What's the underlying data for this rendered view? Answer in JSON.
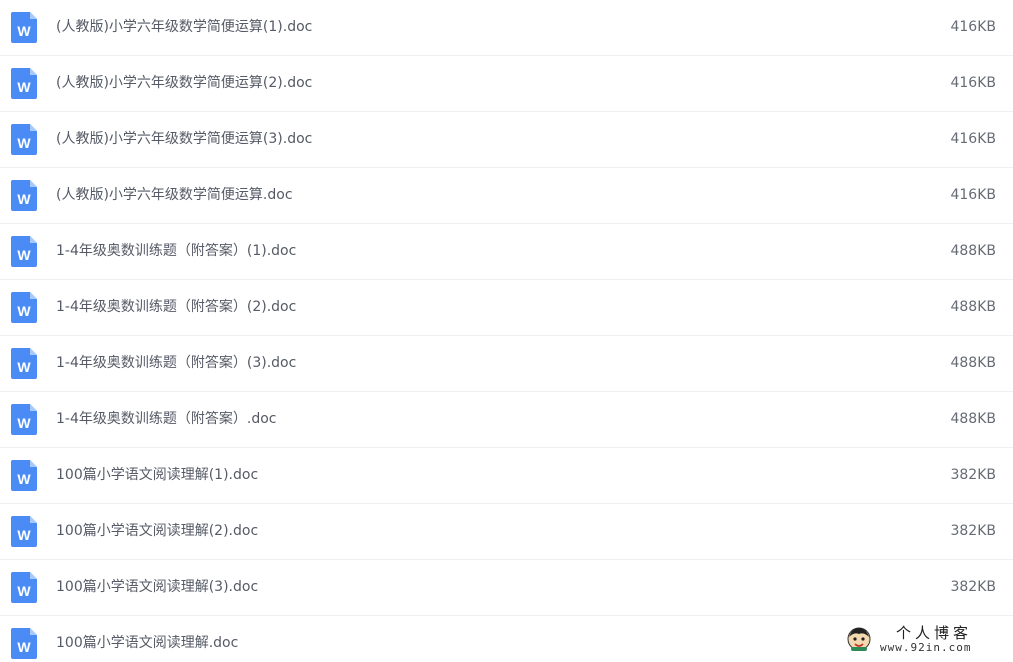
{
  "files": [
    {
      "name": "(人教版)小学六年级数学简便运算(1).doc",
      "size": "416KB",
      "icon": "word-doc-icon"
    },
    {
      "name": "(人教版)小学六年级数学简便运算(2).doc",
      "size": "416KB",
      "icon": "word-doc-icon"
    },
    {
      "name": "(人教版)小学六年级数学简便运算(3).doc",
      "size": "416KB",
      "icon": "word-doc-icon"
    },
    {
      "name": "(人教版)小学六年级数学简便运算.doc",
      "size": "416KB",
      "icon": "word-doc-icon"
    },
    {
      "name": "1-4年级奥数训练题（附答案）(1).doc",
      "size": "488KB",
      "icon": "word-doc-icon"
    },
    {
      "name": "1-4年级奥数训练题（附答案）(2).doc",
      "size": "488KB",
      "icon": "word-doc-icon"
    },
    {
      "name": "1-4年级奥数训练题（附答案）(3).doc",
      "size": "488KB",
      "icon": "word-doc-icon"
    },
    {
      "name": "1-4年级奥数训练题（附答案）.doc",
      "size": "488KB",
      "icon": "word-doc-icon"
    },
    {
      "name": "100篇小学语文阅读理解(1).doc",
      "size": "382KB",
      "icon": "word-doc-icon"
    },
    {
      "name": "100篇小学语文阅读理解(2).doc",
      "size": "382KB",
      "icon": "word-doc-icon"
    },
    {
      "name": "100篇小学语文阅读理解(3).doc",
      "size": "382KB",
      "icon": "word-doc-icon"
    },
    {
      "name": "100篇小学语文阅读理解.doc",
      "size": "",
      "icon": "word-doc-icon"
    }
  ],
  "watermark": {
    "title": "个人博客",
    "url": "www.92in.com"
  },
  "colors": {
    "icon_blue": "#4a8bf5",
    "icon_fold": "#a9c8fb",
    "text": "#555a66",
    "divider": "#eef0f3"
  }
}
